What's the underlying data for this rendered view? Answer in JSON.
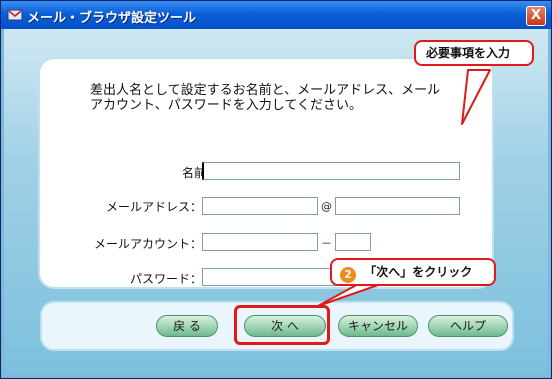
{
  "window": {
    "title": "メール・ブラウザ設定ツール",
    "close_label": "X"
  },
  "instruction": {
    "line1": "差出人名として設定するお名前と、メールアドレス、メール",
    "line2": "アカウント、パスワードを入力してください。"
  },
  "form": {
    "name_label": "名前：",
    "name_value": "",
    "email_label": "メールアドレス：",
    "email_user_value": "",
    "email_at": "@",
    "email_domain_value": "",
    "account_label": "メールアカウント：",
    "account_value": "",
    "account_sep": "－",
    "account_suffix_value": "",
    "password_label": "パスワード：",
    "password_value": ""
  },
  "buttons": {
    "back": "戻 る",
    "next": "次 へ",
    "cancel": "キャンセル",
    "help": "ヘルプ"
  },
  "callouts": {
    "required": "必要事項を入力",
    "step_number": "2",
    "next_instruction": "「次へ」をクリック"
  },
  "colors": {
    "titlebar": "#0a5fd8",
    "callout_border": "#e01a1a",
    "button_fill": "#9ed3b2",
    "step_badge": "#f08a1c"
  },
  "icons": {
    "app": "window-app-icon",
    "close": "close-icon"
  }
}
